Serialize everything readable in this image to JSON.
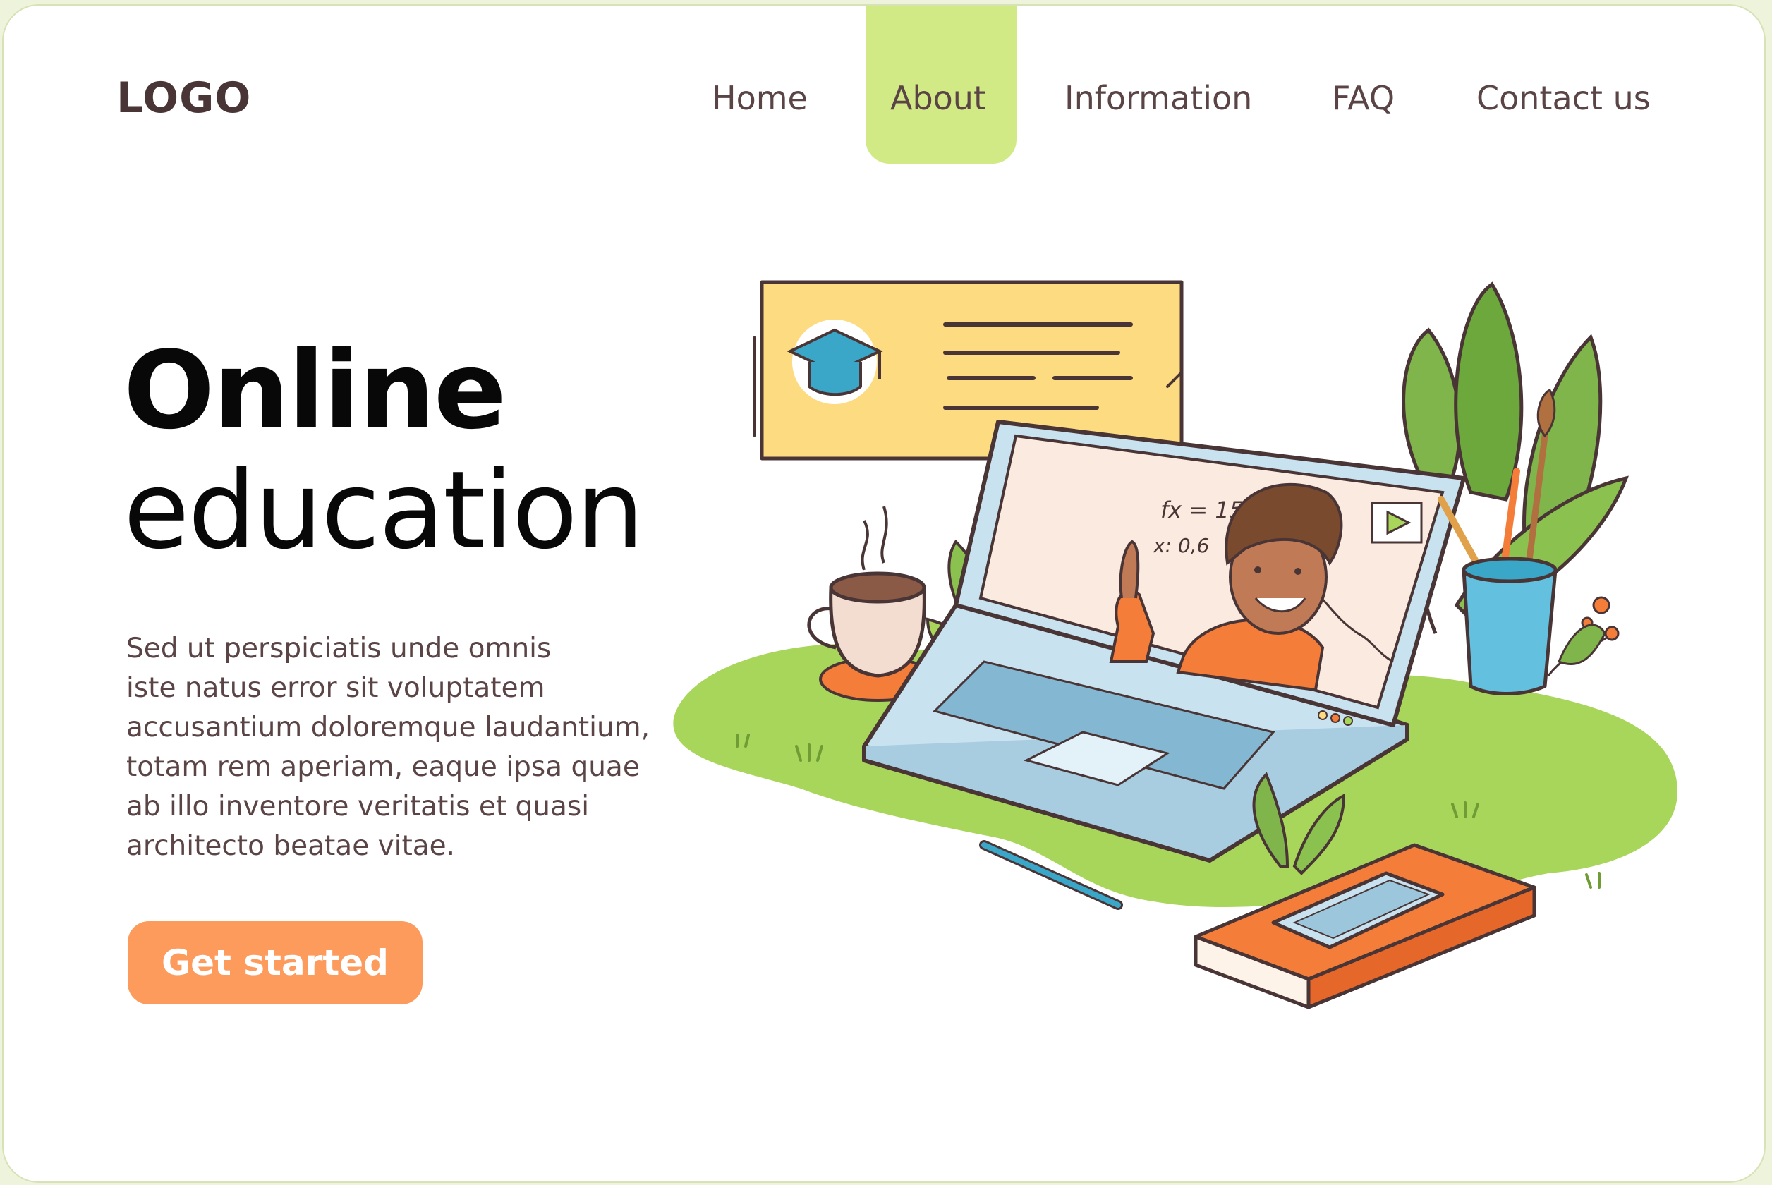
{
  "header": {
    "logo": "LOGO",
    "nav": [
      {
        "label": "Home"
      },
      {
        "label": "About",
        "active": true
      },
      {
        "label": "Information"
      },
      {
        "label": "FAQ"
      },
      {
        "label": "Contact us"
      }
    ]
  },
  "hero": {
    "title_line1": "Online",
    "title_line2": "education",
    "paragraph_lines": [
      "Sed ut perspiciatis unde omnis",
      "iste natus error sit voluptatem",
      "accusantium doloremque laudantium,",
      "totam rem aperiam, eaque ipsa quae",
      "ab illo inventore veritatis et quasi",
      "architecto beatae vitae."
    ],
    "cta_label": "Get started"
  },
  "illustration": {
    "board_text_1": "fx = 15",
    "board_text_2": "x: 0,6"
  },
  "colors": {
    "nav_active": "#d2ea86",
    "cta": "#fc9b5c",
    "grass": "#a8d65a",
    "bubble": "#fddb80",
    "laptop": "#c9e2ef",
    "book": "#f57d3a",
    "cup": "#63c1df"
  },
  "icons": [
    "graduation-cap-icon",
    "play-icon",
    "coffee-cup-icon",
    "phone-icon",
    "pen-icon"
  ]
}
